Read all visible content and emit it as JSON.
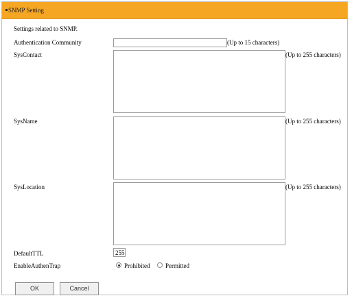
{
  "header": {
    "title": "SNMP Setting",
    "bg_color": "#f5a623"
  },
  "intro": "Settings related to SNMP.",
  "auth_community": {
    "label": "Authentication Community",
    "value": "",
    "hint": "(Up to 15 characters)"
  },
  "sys_contact": {
    "label": "SysContact",
    "value": "",
    "hint": "(Up to 255 characters)"
  },
  "sys_name": {
    "label": "SysName",
    "value": "",
    "hint": "(Up to 255 characters)"
  },
  "sys_location": {
    "label": "SysLocation",
    "value": "",
    "hint": "(Up to 255 characters)"
  },
  "default_ttl": {
    "label": "DefaultTTL",
    "value": "255"
  },
  "enable_authen_trap": {
    "label": "EnableAuthenTrap",
    "options": [
      "Prohibited",
      "Permitted"
    ],
    "selected": "Prohibited"
  },
  "buttons": {
    "ok": "OK",
    "cancel": "Cancel"
  }
}
